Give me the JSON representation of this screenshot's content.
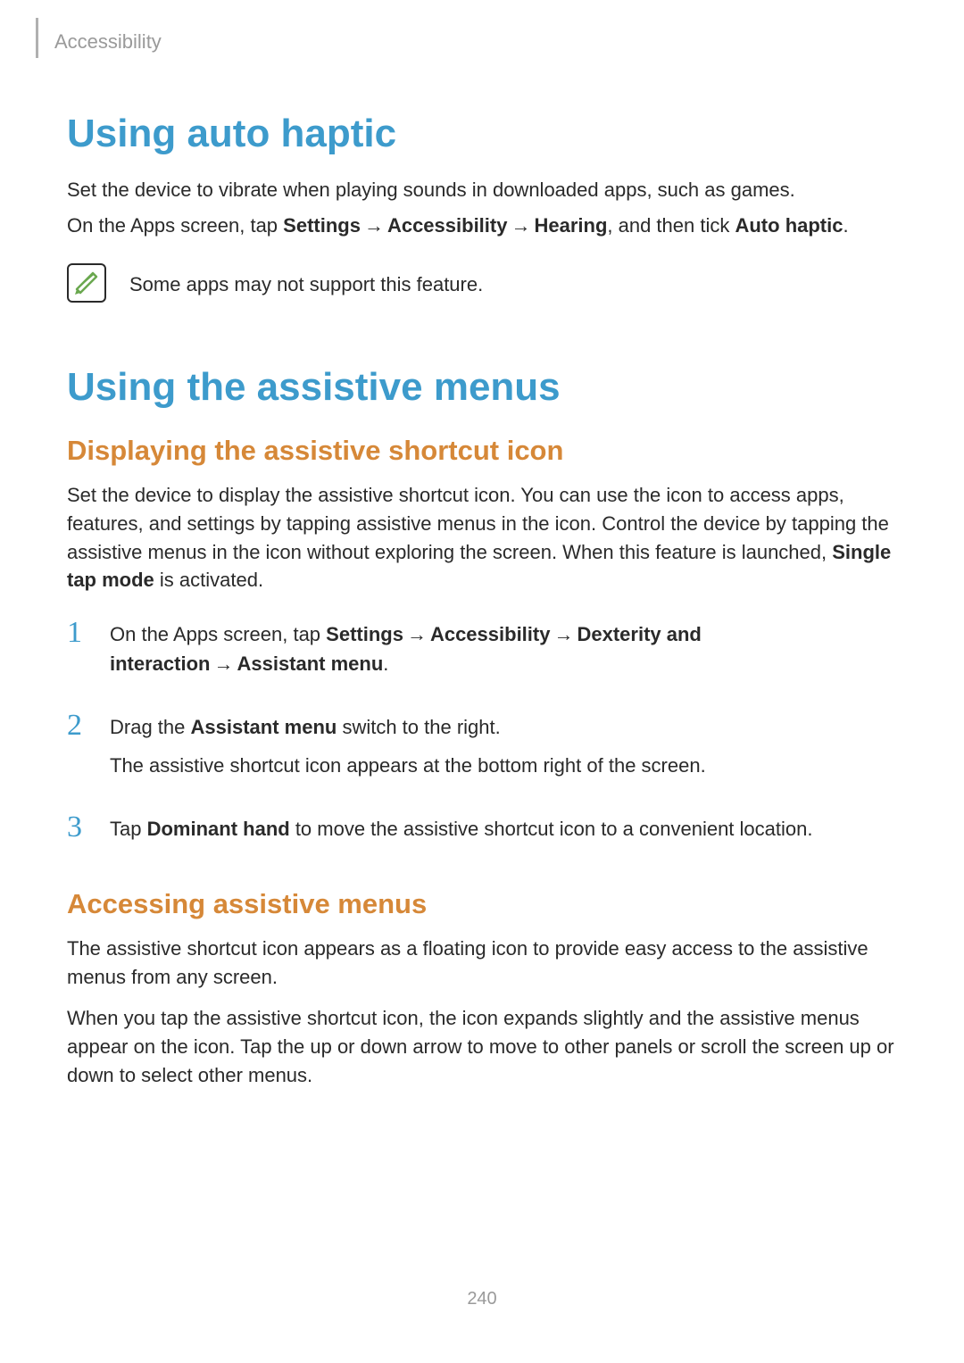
{
  "header": {
    "breadcrumb": "Accessibility"
  },
  "section1": {
    "title": "Using auto haptic",
    "p1": "Set the device to vibrate when playing sounds in downloaded apps, such as games.",
    "p2_a": "On the Apps screen, tap ",
    "p2_b1": "Settings",
    "p2_b2": "Accessibility",
    "p2_b3": "Hearing",
    "p2_c": ", and then tick ",
    "p2_b4": "Auto haptic",
    "p2_d": ".",
    "note": "Some apps may not support this feature."
  },
  "section2": {
    "title": "Using the assistive menus",
    "sub1": {
      "title": "Displaying the assistive shortcut icon",
      "p1_a": "Set the device to display the assistive shortcut icon. You can use the icon to access apps, features, and settings by tapping assistive menus in the icon. Control the device by tapping the assistive menus in the icon without exploring the screen. When this feature is launched, ",
      "p1_b": "Single tap mode",
      "p1_c": " is activated.",
      "step1_a": "On the Apps screen, tap ",
      "step1_b1": "Settings",
      "step1_b2": "Accessibility",
      "step1_b3": "Dexterity and interaction",
      "step1_b4": "Assistant menu",
      "step1_d": ".",
      "step2_a": "Drag the ",
      "step2_b": "Assistant menu",
      "step2_c": " switch to the right.",
      "step2_p2": "The assistive shortcut icon appears at the bottom right of the screen.",
      "step3_a": "Tap ",
      "step3_b": "Dominant hand",
      "step3_c": " to move the assistive shortcut icon to a convenient location."
    },
    "sub2": {
      "title": "Accessing assistive menus",
      "p1": "The assistive shortcut icon appears as a floating icon to provide easy access to the assistive menus from any screen.",
      "p2": "When you tap the assistive shortcut icon, the icon expands slightly and the assistive menus appear on the icon. Tap the up or down arrow to move to other panels or scroll the screen up or down to select other menus."
    }
  },
  "nums": {
    "n1": "1",
    "n2": "2",
    "n3": "3"
  },
  "arrow": "→",
  "pageNumber": "240"
}
